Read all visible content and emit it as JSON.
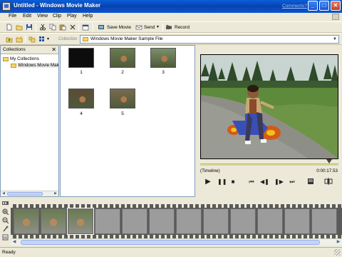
{
  "window": {
    "title": "Untitled - Windows Movie Maker",
    "comments_link": "Comments?",
    "controls": {
      "minimize": "_",
      "maximize": "□",
      "close": "✕"
    }
  },
  "menu": {
    "items": [
      "File",
      "Edit",
      "View",
      "Clip",
      "Play",
      "Help"
    ]
  },
  "toolbar": {
    "save_movie": "Save Movie",
    "send": "Send",
    "record": "Record",
    "icons": [
      "new-icon",
      "open-icon",
      "save-icon",
      "cut-icon",
      "copy-icon",
      "paste-icon",
      "delete-icon",
      "properties-icon",
      "save-movie-icon",
      "send-icon",
      "record-icon"
    ]
  },
  "collection_bar": {
    "label": "Collection",
    "selected": "Windows Movie Maker Sample File"
  },
  "collections_pane": {
    "header": "Collections",
    "close": "✕",
    "tree": [
      "My Collections",
      "Windows Movie Maker Sample File"
    ]
  },
  "clips": [
    {
      "label": "1",
      "tone": "#0d0d0d"
    },
    {
      "label": "2",
      "tone": "#6b7a52"
    },
    {
      "label": "3",
      "tone": "#7d8f6a"
    },
    {
      "label": "4",
      "tone": "#5e4a36"
    },
    {
      "label": "5",
      "tone": "#7a6a50"
    }
  ],
  "preview": {
    "timeline_label": "(Timeline)",
    "time": "0:00:17.53",
    "controls": [
      "play",
      "pause",
      "stop",
      "previous-frame",
      "rewind",
      "forward",
      "next-frame",
      "full-screen",
      "split"
    ]
  },
  "storyboard": {
    "populated_frames": 3,
    "total_frames": 12
  },
  "status": {
    "text": "Ready"
  }
}
